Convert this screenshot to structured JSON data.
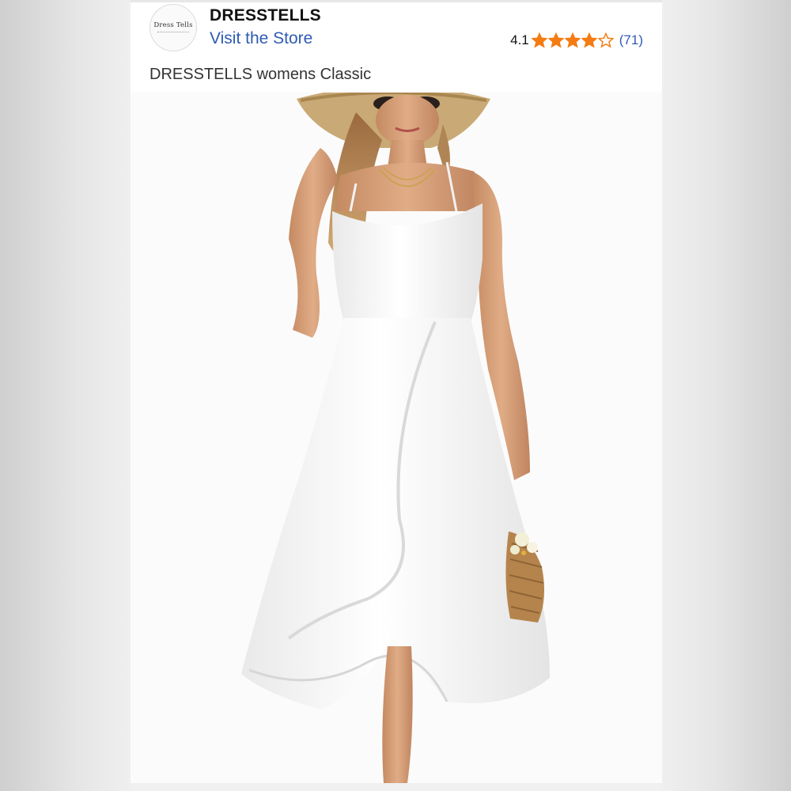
{
  "store": {
    "logo_text": "Dress Tells",
    "brand_name": "DRESSTELLS",
    "link_label": "Visit the Store"
  },
  "rating": {
    "value": "4.1",
    "stars": 4.1,
    "max": 5,
    "count_label": "(71)",
    "star_color": "#f47c12",
    "link_color": "#2f5bb5"
  },
  "product": {
    "title": "DRESSTELLS womens Classic"
  },
  "icons": {
    "star": "star-icon",
    "logo": "brand-logo"
  }
}
